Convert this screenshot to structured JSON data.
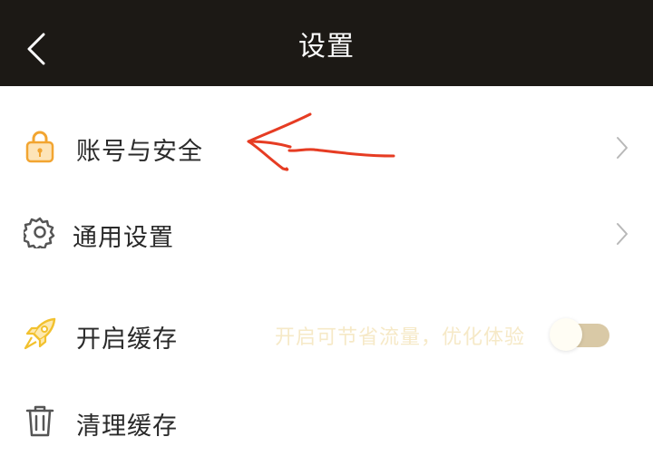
{
  "header": {
    "title": "设置",
    "back_icon": "chevron-left-icon",
    "background": "#1c1915"
  },
  "settings": {
    "account": {
      "label": "账号与安全",
      "icon": "lock-icon"
    },
    "general": {
      "label": "通用设置",
      "icon": "gear-icon"
    },
    "cache": {
      "label": "开启缓存",
      "icon": "rocket-icon",
      "hint": "开启可节省流量，优化体验",
      "enabled": false
    },
    "clear_cache": {
      "label": "清理缓存",
      "icon": "trash-icon"
    }
  },
  "colors": {
    "accent": "#f2a531",
    "annotation": "#e63c23",
    "toggle_track": "#d9c9a6"
  }
}
